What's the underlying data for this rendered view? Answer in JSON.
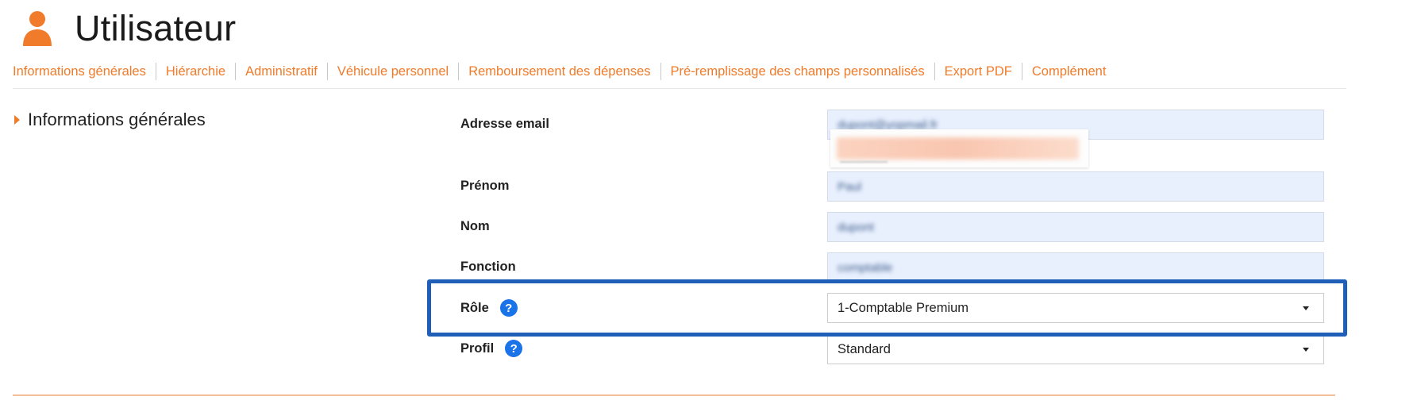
{
  "header": {
    "title": "Utilisateur",
    "icon": "user-icon",
    "icon_color": "#f07b2a"
  },
  "tabs": [
    {
      "label": "Informations générales"
    },
    {
      "label": "Hiérarchie"
    },
    {
      "label": "Administratif"
    },
    {
      "label": "Véhicule personnel"
    },
    {
      "label": "Remboursement des dépenses"
    },
    {
      "label": "Pré-remplissage des champs personnalisés"
    },
    {
      "label": "Export PDF"
    },
    {
      "label": "Complément"
    }
  ],
  "section": {
    "title": "Informations générales"
  },
  "form": {
    "email": {
      "label": "Adresse email",
      "value": "dupont@yopmail.fr"
    },
    "first_name": {
      "label": "Prénom",
      "value": "Paul"
    },
    "last_name": {
      "label": "Nom",
      "value": "dupont"
    },
    "function": {
      "label": "Fonction",
      "value": "comptable"
    },
    "role": {
      "label": "Rôle",
      "help": "?",
      "value": "1-Comptable Premium"
    },
    "profile": {
      "label": "Profil",
      "help": "?",
      "value": "Standard"
    }
  },
  "colors": {
    "accent": "#f07b2a",
    "highlight": "#1f5fb8",
    "help_icon": "#1a73e8",
    "autofill_bg": "#e8f0fe"
  }
}
